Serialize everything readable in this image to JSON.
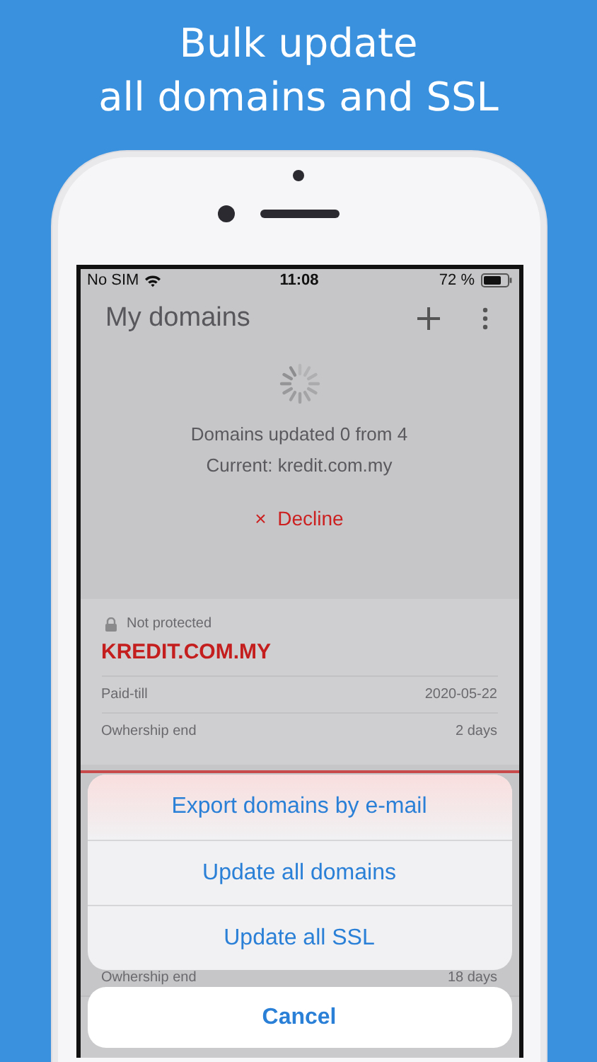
{
  "headline": {
    "lines": [
      "Bulk update",
      "all domains and SSL"
    ]
  },
  "status_bar": {
    "carrier": "No SIM",
    "time": "11:08",
    "battery": "72 %"
  },
  "header": {
    "title": "My domains"
  },
  "progress": {
    "lines": [
      "Domains updated 0 from 4",
      "Current: kredit.com.my"
    ],
    "decline": {
      "icon": "×",
      "label": "Decline"
    }
  },
  "domains": [
    {
      "status": "Not protected",
      "protected": false,
      "name": "KREDIT.COM.MY",
      "rows": [
        {
          "label": "Paid-till",
          "value": "2020-05-22"
        },
        {
          "label": "Owhership end",
          "value": "2 days"
        }
      ]
    },
    {
      "rows": [
        {
          "label": "Owhership end",
          "value": "18 days"
        }
      ]
    }
  ],
  "action_sheet": {
    "actions": [
      "Export domains by e-mail",
      "Update all domains",
      "Update all SSL"
    ],
    "cancel": "Cancel"
  }
}
